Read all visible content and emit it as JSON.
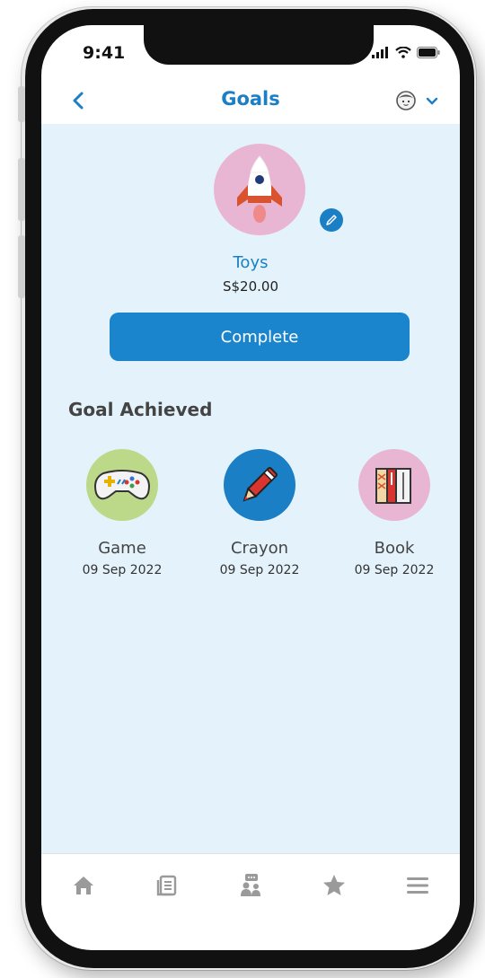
{
  "status_bar": {
    "time": "9:41"
  },
  "header": {
    "title": "Goals",
    "back_icon": "chevron-left-icon",
    "profile_icon": "child-face-icon",
    "dropdown_icon": "chevron-down-icon"
  },
  "goal": {
    "icon": "rocket-icon",
    "name": "Toys",
    "amount": "S$20.00",
    "edit_icon": "pencil-icon",
    "complete_label": "Complete"
  },
  "achieved": {
    "title": "Goal Achieved",
    "items": [
      {
        "name": "Game",
        "date": "09 Sep 2022",
        "icon": "gamepad-icon",
        "bg": "#bcd98a"
      },
      {
        "name": "Crayon",
        "date": "09 Sep 2022",
        "icon": "crayon-icon",
        "bg": "#1a7fc4"
      },
      {
        "name": "Book",
        "date": "09 Sep 2022",
        "icon": "books-icon",
        "bg": "#e8b6d3"
      }
    ]
  },
  "bottom_nav": [
    "home-icon",
    "news-icon",
    "people-chat-icon",
    "star-icon",
    "menu-icon"
  ],
  "colors": {
    "accent": "#1a7fc4",
    "background": "#e4f3fb",
    "button": "#1a85cc"
  }
}
